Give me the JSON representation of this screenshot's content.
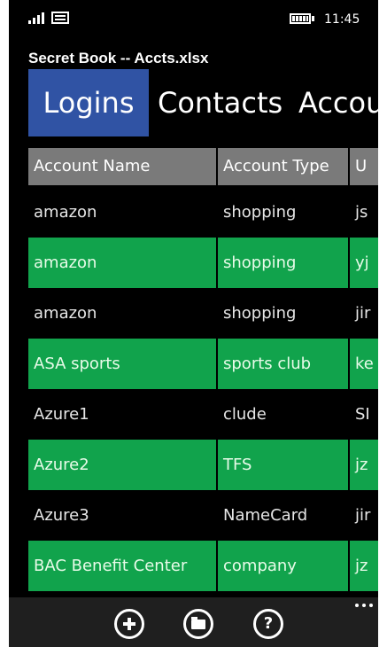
{
  "status_bar": {
    "time": "11:45",
    "icons": [
      "signal-icon",
      "message-icon",
      "battery-icon"
    ]
  },
  "app": {
    "title": "Secret Book -- Accts.xlsx"
  },
  "tabs": [
    {
      "label": "Logins",
      "active": true
    },
    {
      "label": "Contacts",
      "active": false
    },
    {
      "label": "Accoun",
      "active": false
    }
  ],
  "grid": {
    "columns": [
      "Account Name",
      "Account Type",
      "U"
    ],
    "rows": [
      {
        "name": "amazon",
        "type": "shopping",
        "user": "js",
        "highlighted": false
      },
      {
        "name": "amazon",
        "type": "shopping",
        "user": "yj",
        "highlighted": true
      },
      {
        "name": "amazon",
        "type": "shopping",
        "user": "jir",
        "highlighted": false
      },
      {
        "name": "ASA sports",
        "type": "sports club",
        "user": "ke",
        "highlighted": true
      },
      {
        "name": "Azure1",
        "type": "clude",
        "user": "SI",
        "highlighted": false
      },
      {
        "name": "Azure2",
        "type": "TFS",
        "user": "jz",
        "highlighted": true
      },
      {
        "name": "Azure3",
        "type": "NameCard",
        "user": "jir",
        "highlighted": false
      },
      {
        "name": "BAC Benefit Center",
        "type": "company",
        "user": "jz",
        "highlighted": true
      }
    ]
  },
  "app_bar": {
    "buttons": [
      "add-icon",
      "folder-icon",
      "help-icon"
    ],
    "more": "more-icon"
  },
  "colors": {
    "accent": "#3053a4",
    "highlight_row": "#11a34c",
    "header": "#7a7a7a",
    "background": "#000000"
  }
}
